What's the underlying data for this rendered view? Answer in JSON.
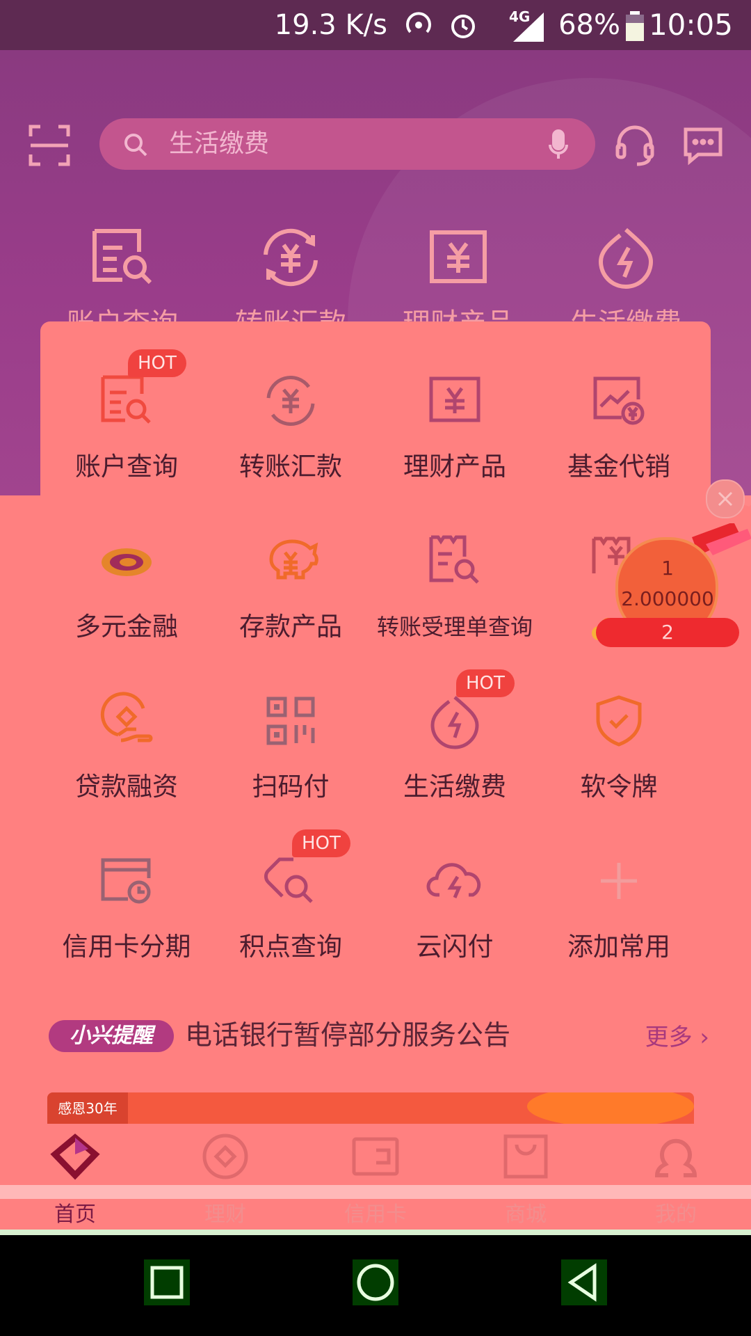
{
  "status_bar": {
    "speed": "19.3 K/s",
    "network": "4G",
    "battery": "68%",
    "time": "10:05"
  },
  "search": {
    "placeholder": "生活缴费"
  },
  "quick_actions": [
    {
      "label": "账户查询",
      "icon": "account-query-icon"
    },
    {
      "label": "转账汇款",
      "icon": "transfer-icon"
    },
    {
      "label": "理财产品",
      "icon": "wealth-product-icon"
    },
    {
      "label": "生活缴费",
      "icon": "utility-payment-icon"
    }
  ],
  "grid": [
    {
      "label": "账户查询",
      "icon": "account-query-icon",
      "badge": "HOT"
    },
    {
      "label": "转账汇款",
      "icon": "transfer-icon"
    },
    {
      "label": "理财产品",
      "icon": "wealth-product-icon"
    },
    {
      "label": "基金代销",
      "icon": "fund-icon"
    },
    {
      "label": "多元金融",
      "icon": "diversified-finance-icon"
    },
    {
      "label": "存款产品",
      "icon": "piggy-bank-icon"
    },
    {
      "label": "转账受理单查询",
      "icon": "transfer-receipt-query-icon"
    },
    {
      "label": "",
      "icon": "wallet-icon"
    },
    {
      "label": "贷款融资",
      "icon": "loan-icon"
    },
    {
      "label": "扫码付",
      "icon": "qr-scan-icon"
    },
    {
      "label": "生活缴费",
      "icon": "utility-payment-icon",
      "badge": "HOT"
    },
    {
      "label": "软令牌",
      "icon": "shield-icon"
    },
    {
      "label": "信用卡分期",
      "icon": "credit-card-installment-icon"
    },
    {
      "label": "积点查询",
      "icon": "points-query-icon",
      "badge": "HOT"
    },
    {
      "label": "云闪付",
      "icon": "cloud-pay-icon"
    },
    {
      "label": "添加常用",
      "icon": "plus-icon"
    }
  ],
  "promo": {
    "line1": "1",
    "line2": "2.000000",
    "line3": "2"
  },
  "notice": {
    "tag": "小兴提醒",
    "text": "电话银行暂停部分服务公告",
    "more": "更多"
  },
  "banner": {
    "tag": "感恩30年"
  },
  "bottom_nav": [
    {
      "label": "首页",
      "active": true
    },
    {
      "label": "理财"
    },
    {
      "label": "信用卡"
    },
    {
      "label": "商城"
    },
    {
      "label": "我的"
    }
  ]
}
